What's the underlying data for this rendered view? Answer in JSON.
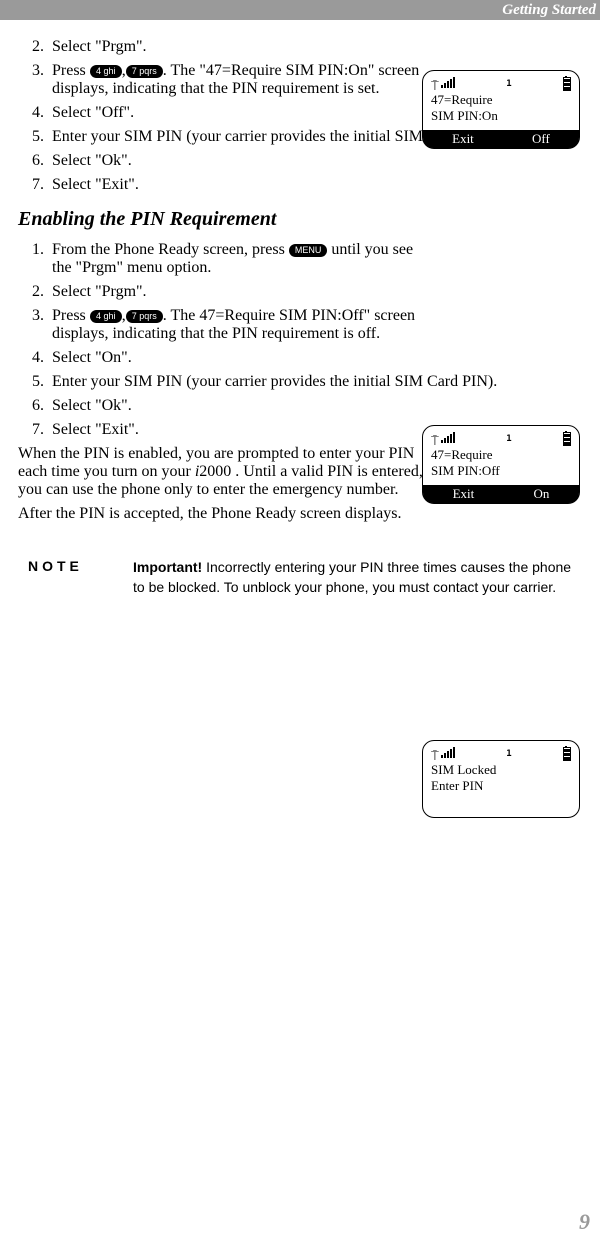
{
  "header": {
    "title": "Getting Started"
  },
  "block1": {
    "s2": "Select \"Prgm\".",
    "s3a": "Press ",
    "key4": "4 ghi",
    "comma": ",",
    "key7": "7 pqrs",
    "s3b": ".  The \"47=Require SIM PIN:On\" screen displays, indicating that the PIN requirement is set.",
    "s4": "Select \"Off\".",
    "s5": "Enter your SIM PIN (your carrier provides the initial SIM Card PIN).",
    "s6": "Select \"Ok\".",
    "s7": "Select \"Exit\"."
  },
  "screen1": {
    "one": "1",
    "l1": "47=Require",
    "l2": "SIM PIN:On",
    "left": "Exit",
    "right": "Off"
  },
  "section_head": "Enabling the PIN Requirement",
  "block2": {
    "s1a": "From the Phone Ready screen, press ",
    "keyMenu": "MENU",
    "s1b": " until you see the \"Prgm\" menu option.",
    "s2": "Select \"Prgm\".",
    "s3a": "Press ",
    "key4": "4 ghi",
    "comma": ",",
    "key7": "7 pqrs",
    "s3b": ".   The 47=Require SIM PIN:Off\" screen displays, indicating that the PIN requirement is off.",
    "s4": "Select \"On\".",
    "s5": "Enter your SIM PIN (your carrier provides the initial SIM Card PIN).",
    "s6": "Select \"Ok\".",
    "s7": "Select \"Exit\"."
  },
  "screen2": {
    "one": "1",
    "l1": "47=Require",
    "l2": "SIM PIN:Off",
    "left": "Exit",
    "right": "On"
  },
  "para1a": "When the PIN is enabled, you are prompted to enter your PIN each time you turn on your ",
  "para1_model": "i",
  "para1_model2": "2000 . Until a valid PIN is entered, you can use the phone only to enter the emergency number.",
  "para2": "After the PIN is accepted, the Phone Ready screen displays.",
  "screen3": {
    "one": "1",
    "l1": "SIM Locked",
    "l2": "Enter PIN"
  },
  "note": {
    "label": "NOTE",
    "bold": "Important!",
    "text": " Incorrectly entering your PIN three times causes the phone to be blocked. To unblock your phone, you must contact your carrier."
  },
  "page_number": "9"
}
